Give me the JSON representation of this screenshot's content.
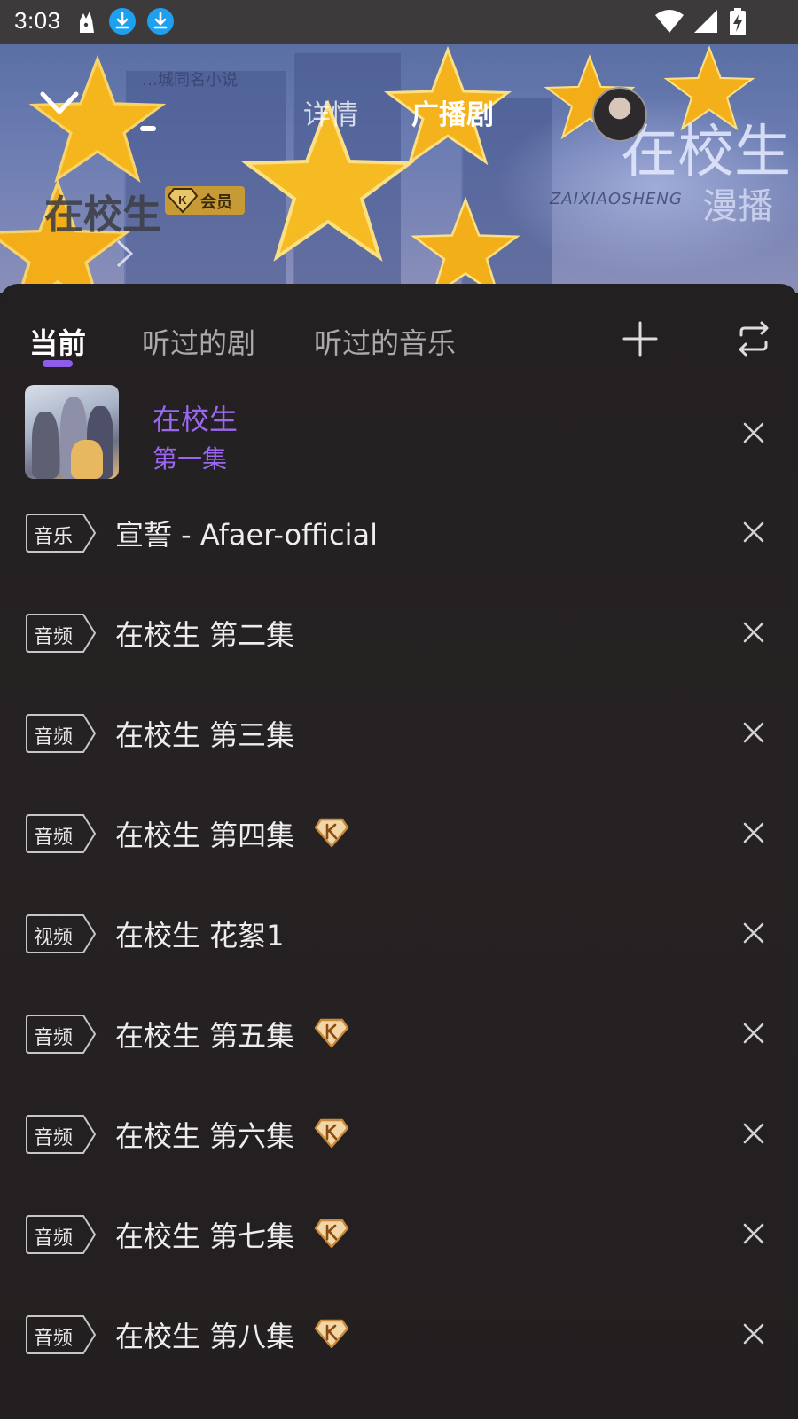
{
  "status_bar": {
    "time": "3:03",
    "icons": [
      "app-icon",
      "download-icon",
      "download-icon",
      "wifi-icon",
      "signal-icon",
      "battery-charging-icon"
    ]
  },
  "hero": {
    "small_text": "…城同名小说",
    "tabs": [
      "详情",
      "广播剧"
    ],
    "active_tab": "广播剧",
    "title": "在校生",
    "vip_label": "会员",
    "logo_text": "在校生",
    "logo_sub": "ZAIXIAOSHENG",
    "logo_extra": "漫播"
  },
  "sheet": {
    "tabs": [
      "当前",
      "听过的剧",
      "听过的音乐"
    ],
    "active_tab": "当前",
    "accent_color": "#8d5ce8",
    "current": {
      "title": "在校生",
      "subtitle": "第一集"
    },
    "items": [
      {
        "tag": "音乐",
        "title": "宣誓 - Afaer-official",
        "vip": false
      },
      {
        "tag": "音频",
        "title": "在校生 第二集",
        "vip": false
      },
      {
        "tag": "音频",
        "title": "在校生 第三集",
        "vip": false
      },
      {
        "tag": "音频",
        "title": "在校生 第四集",
        "vip": true
      },
      {
        "tag": "视频",
        "title": "在校生 花絮1",
        "vip": false
      },
      {
        "tag": "音频",
        "title": "在校生 第五集",
        "vip": true
      },
      {
        "tag": "音频",
        "title": "在校生 第六集",
        "vip": true
      },
      {
        "tag": "音频",
        "title": "在校生 第七集",
        "vip": true
      },
      {
        "tag": "音频",
        "title": "在校生 第八集",
        "vip": true
      }
    ]
  }
}
